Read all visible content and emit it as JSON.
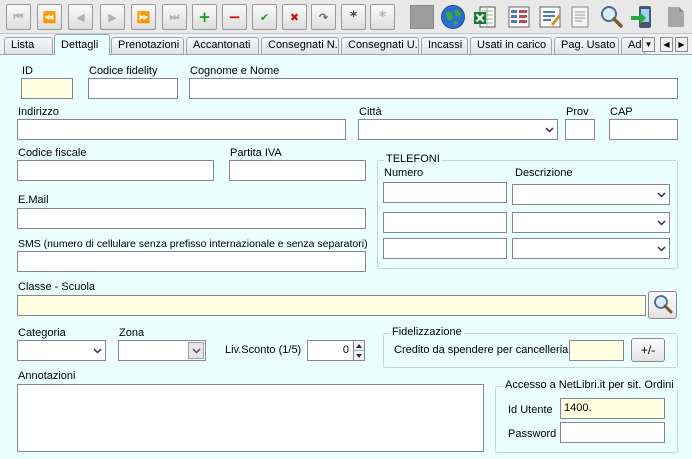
{
  "toolbar": {
    "nav": [
      {
        "name": "first-record-button",
        "glyph": "⏮"
      },
      {
        "name": "prev-page-button",
        "glyph": "⏪"
      },
      {
        "name": "prev-record-button",
        "glyph": "◀"
      },
      {
        "name": "next-record-button",
        "glyph": "▶"
      },
      {
        "name": "next-page-button",
        "glyph": "⏩"
      },
      {
        "name": "last-record-button",
        "glyph": "⏭"
      }
    ],
    "actions": [
      {
        "name": "add-record-button",
        "glyph": "+",
        "color": "#1a9c1a"
      },
      {
        "name": "delete-record-button",
        "glyph": "−",
        "color": "#d01010"
      },
      {
        "name": "confirm-button",
        "glyph": "✔",
        "color": "#1a9c1a"
      },
      {
        "name": "cancel-button",
        "glyph": "✖",
        "color": "#d01010"
      },
      {
        "name": "refresh-button",
        "glyph": "↷",
        "color": "#666666"
      },
      {
        "name": "filter-button",
        "glyph": "*",
        "color": "#444444"
      },
      {
        "name": "clear-filter-button",
        "glyph": "*",
        "color": "#b0b0b0"
      }
    ]
  },
  "tabs": [
    "Lista",
    "Dettagli",
    "Prenotazioni",
    "Accantonati",
    "Consegnati N.",
    "Consegnati U.",
    "Incassi",
    "Usati in carico",
    "Pag. Usato",
    "Ad"
  ],
  "active_tab": "Dettagli",
  "form": {
    "id_label": "ID",
    "id_value": "",
    "fidelity_label": "Codice fidelity",
    "fidelity_value": "",
    "name_label": "Cognome e Nome",
    "name_value": "",
    "address_label": "Indirizzo",
    "address_value": "",
    "city_label": "Città",
    "city_value": "",
    "prov_label": "Prov",
    "prov_value": "",
    "cap_label": "CAP",
    "cap_value": "",
    "cf_label": "Codice fiscale",
    "cf_value": "",
    "piva_label": "Partita IVA",
    "piva_value": "",
    "email_label": "E.Mail",
    "email_value": "",
    "sms_label": "SMS (numero di cellulare senza prefisso internazionale e senza separatori)",
    "sms_value": "",
    "class_label": "Classe - Scuola",
    "class_value": "",
    "category_label": "Categoria",
    "category_value": "",
    "zone_label": "Zona",
    "zone_value": "",
    "discount_label": "Liv.Sconto (1/5)",
    "discount_value": "0",
    "notes_label": "Annotazioni",
    "notes_value": ""
  },
  "phones": {
    "title": "TELEFONI",
    "number_header": "Numero",
    "desc_header": "Descrizione",
    "rows": [
      {
        "number": "",
        "desc": ""
      },
      {
        "number": "",
        "desc": ""
      },
      {
        "number": "",
        "desc": ""
      }
    ]
  },
  "loyalty": {
    "title": "Fidelizzazione",
    "credit_label": "Credito da spendere per cancelleria:",
    "credit_value": "",
    "adjust_label": "+/-"
  },
  "netlibri": {
    "title": "Accesso a NetLibri.it per sit. Ordini",
    "user_label": "Id Utente",
    "user_value": "1400.",
    "password_label": "Password",
    "password_value": ""
  },
  "colors": {
    "panel_bg": "#ebfffd",
    "highlight_field": "#ffffe1"
  }
}
